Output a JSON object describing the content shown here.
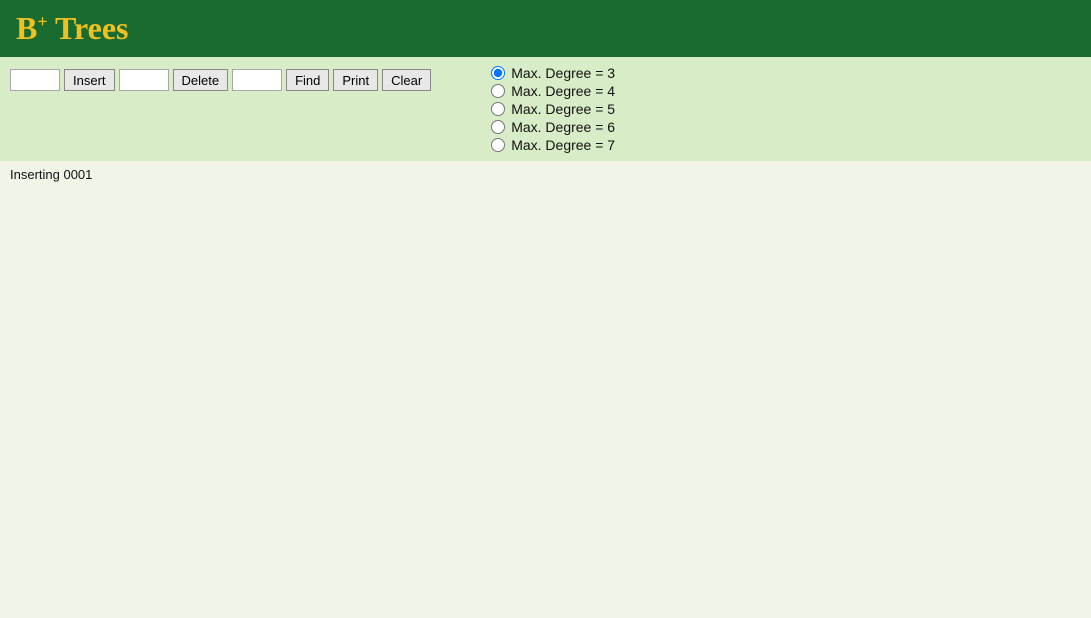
{
  "header": {
    "title_b": "B",
    "title_plus": "+",
    "title_rest": " Trees"
  },
  "toolbar": {
    "insert_input_value": "",
    "insert_button_label": "Insert",
    "delete_input_value": "",
    "delete_button_label": "Delete",
    "find_input_value": "",
    "find_button_label": "Find",
    "print_button_label": "Print",
    "clear_button_label": "Clear"
  },
  "radio_group": {
    "label_prefix": "Max. Degree = ",
    "options": [
      {
        "value": "3",
        "label": "Max. Degree = 3",
        "checked": true
      },
      {
        "value": "4",
        "label": "Max. Degree = 4",
        "checked": false
      },
      {
        "value": "5",
        "label": "Max. Degree = 5",
        "checked": false
      },
      {
        "value": "6",
        "label": "Max. Degree = 6",
        "checked": false
      },
      {
        "value": "7",
        "label": "Max. Degree = 7",
        "checked": false
      }
    ]
  },
  "status": {
    "message": "Inserting 0001"
  },
  "colors": {
    "header_bg": "#1a6b2f",
    "title_color": "#f0c020",
    "toolbar_bg": "#d8ecc8",
    "body_bg": "#f0f5e8"
  }
}
